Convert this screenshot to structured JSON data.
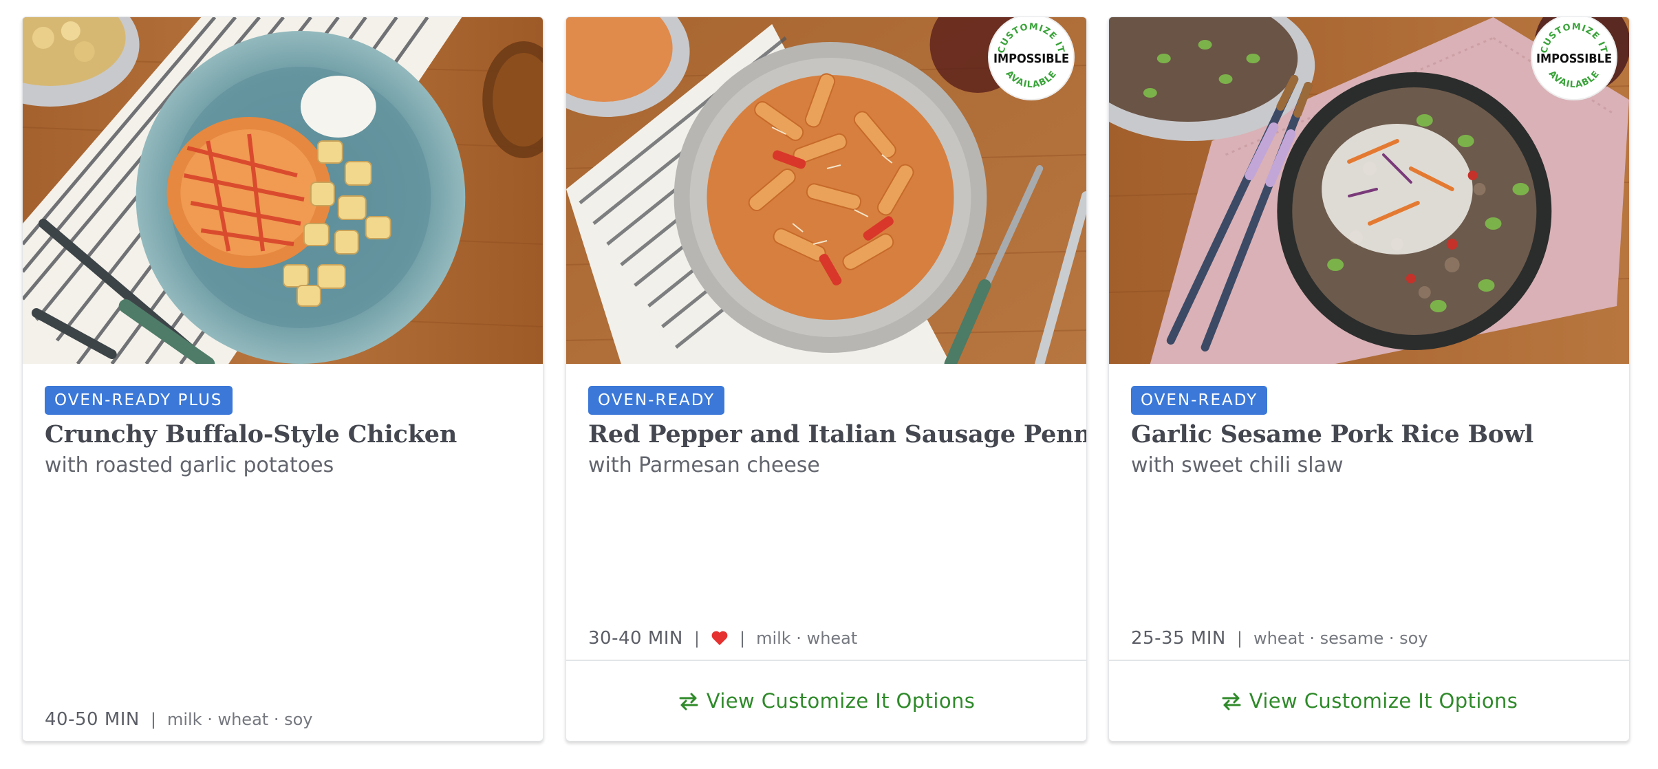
{
  "colors": {
    "tag_bg": "#3b78d8",
    "tag_text": "#ffffff",
    "title": "#44474f",
    "link_green": "#2f8a2a",
    "heart_red": "#e5312f",
    "impossible_green": "#3aa33a"
  },
  "cards": [
    {
      "tag": "OVEN-READY PLUS",
      "title": "Crunchy Buffalo-Style Chicken",
      "subtitle": "with roasted garlic potatoes",
      "time": "40-50 MIN",
      "separator": "|",
      "allergens": "milk · wheat · soy",
      "image_icon": "buffalo-chicken-plate-photo"
    },
    {
      "tag": "OVEN-READY",
      "title": "Red Pepper and Italian Sausage Penne",
      "subtitle": "with Parmesan cheese",
      "time": "30-40 MIN",
      "separator": "|",
      "favorite_icon": "heart-icon",
      "allergens": "milk · wheat",
      "badge": {
        "top_text": "CUSTOMIZE IT",
        "brand": "IMPOSSIBLE",
        "bottom_text": "AVAILABLE"
      },
      "footer_icon": "swap-arrows-icon",
      "footer_label": "View Customize It Options",
      "image_icon": "sausage-penne-bowl-photo"
    },
    {
      "tag": "OVEN-READY",
      "title": "Garlic Sesame Pork Rice Bowl",
      "subtitle": "with sweet chili slaw",
      "time": "25-35 MIN",
      "separator": "|",
      "allergens": "wheat · sesame · soy",
      "badge": {
        "top_text": "CUSTOMIZE IT",
        "brand": "IMPOSSIBLE",
        "bottom_text": "AVAILABLE"
      },
      "footer_icon": "swap-arrows-icon",
      "footer_label": "View Customize It Options",
      "image_icon": "pork-rice-bowl-photo"
    }
  ]
}
